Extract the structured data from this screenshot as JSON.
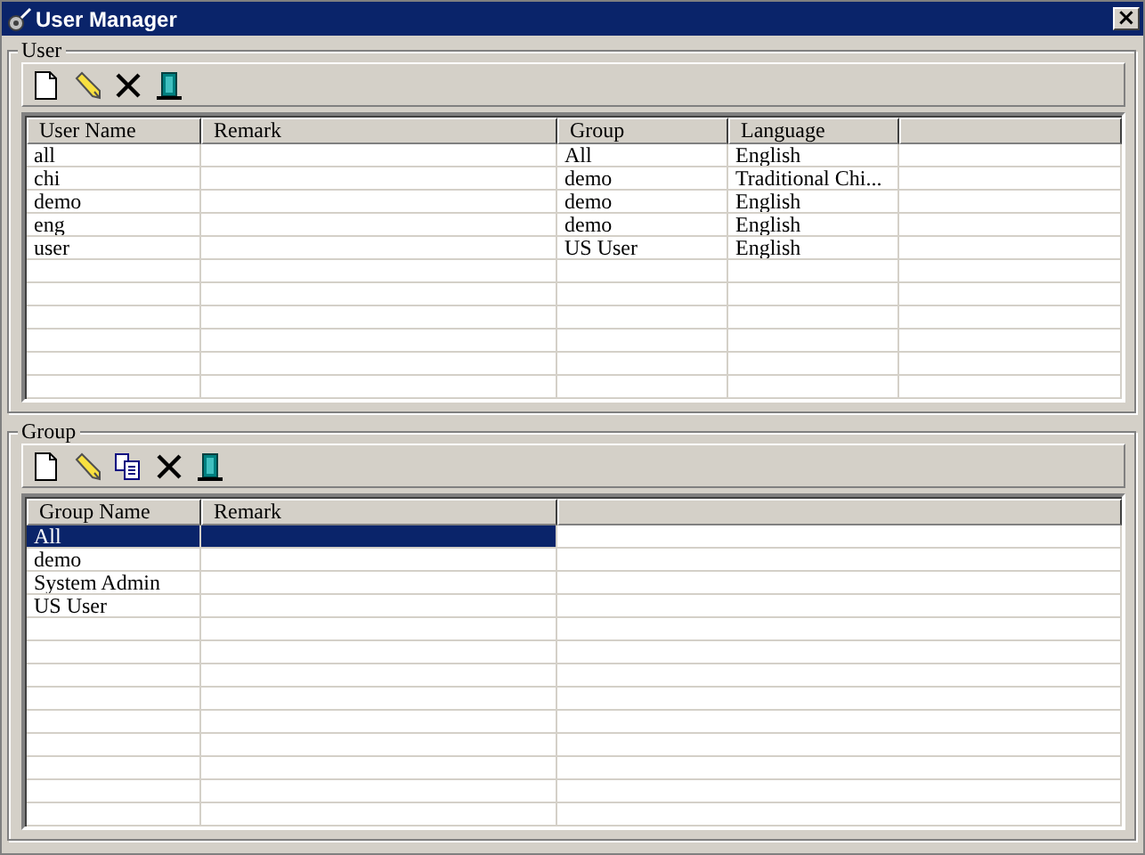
{
  "window": {
    "title": "User Manager",
    "close": "×"
  },
  "user_section": {
    "title": "User",
    "toolbar": [
      {
        "kind": "new"
      },
      {
        "kind": "edit"
      },
      {
        "kind": "delete"
      },
      {
        "kind": "exit"
      }
    ],
    "table": {
      "columns": [
        "User Name",
        "Remark",
        "Group",
        "Language"
      ],
      "rows": [
        {
          "cells": [
            "all",
            "",
            "All",
            "English"
          ],
          "selected": false
        },
        {
          "cells": [
            "chi",
            "",
            "demo",
            "Traditional Chi..."
          ],
          "selected": false
        },
        {
          "cells": [
            "demo",
            "",
            "demo",
            "English"
          ],
          "selected": false
        },
        {
          "cells": [
            "eng",
            "",
            "demo",
            "English"
          ],
          "selected": false
        },
        {
          "cells": [
            "user",
            "",
            "US User",
            "English"
          ],
          "selected": false
        }
      ]
    }
  },
  "group_section": {
    "title": "Group",
    "toolbar": [
      {
        "kind": "new"
      },
      {
        "kind": "edit"
      },
      {
        "kind": "copy"
      },
      {
        "kind": "delete"
      },
      {
        "kind": "exit"
      }
    ],
    "table": {
      "columns": [
        "Group Name",
        "Remark"
      ],
      "rows": [
        {
          "cells": [
            "All",
            ""
          ],
          "selected": true
        },
        {
          "cells": [
            "demo",
            ""
          ],
          "selected": false
        },
        {
          "cells": [
            "System Admin",
            ""
          ],
          "selected": false
        },
        {
          "cells": [
            "US User",
            ""
          ],
          "selected": false
        }
      ]
    }
  }
}
